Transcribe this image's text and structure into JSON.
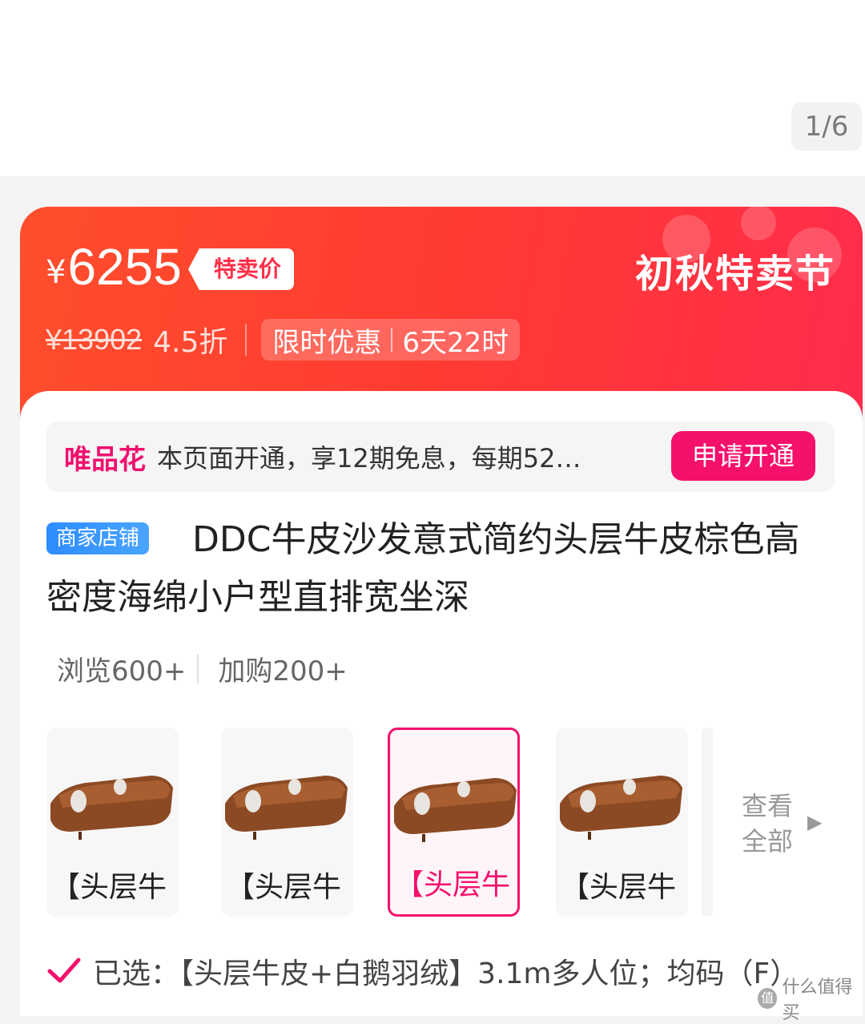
{
  "gallery": {
    "page_counter": "1/6"
  },
  "promo": {
    "currency": "¥",
    "price": "6255",
    "price_tag": "特卖价",
    "festival": "初秋特卖节",
    "original_price": "¥13902",
    "discount": "4.5折",
    "limited_label": "限时优惠",
    "countdown": "6天22时",
    "colors": {
      "gradient_start": "#ff4e2c",
      "gradient_end": "#ff2c4c"
    }
  },
  "credit": {
    "brand": "唯品花",
    "text": "本页面开通，享12期免息，每期52…",
    "apply_label": "申请开通"
  },
  "product": {
    "store_badge": "商家店铺",
    "title": "DDC牛皮沙发意式简约头层牛皮棕色高密度海绵小户型直排宽坐深",
    "views": "浏览600+",
    "carts": "加购200+"
  },
  "variants": {
    "items": [
      {
        "label": "【头层牛",
        "selected": false
      },
      {
        "label": "【头层牛",
        "selected": false
      },
      {
        "label": "【头层牛",
        "selected": true
      },
      {
        "label": "【头层牛",
        "selected": false
      }
    ],
    "view_all": "查看全部"
  },
  "selection": {
    "text": "已选：【头层牛皮+白鹅羽绒】3.1m多人位；均码（F）"
  },
  "watermark": {
    "text": "什么值得买",
    "logo": "值"
  },
  "accent_color": "#f5106c"
}
